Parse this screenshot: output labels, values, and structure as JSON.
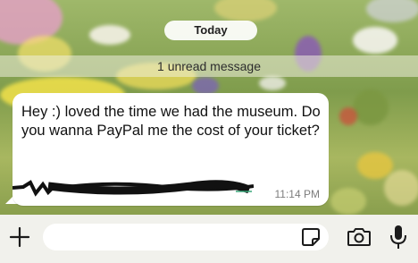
{
  "chat": {
    "date_label": "Today",
    "unread_label": "1 unread message"
  },
  "message": {
    "text": "Hey :) loved the time we had the museum. Do you wanna PayPal me the cost of your ticket?",
    "time": "11:14 PM",
    "redacted": true
  },
  "composer": {
    "input_value": "",
    "icons": [
      "plus-icon",
      "sticker-icon",
      "camera-icon",
      "microphone-icon"
    ]
  }
}
